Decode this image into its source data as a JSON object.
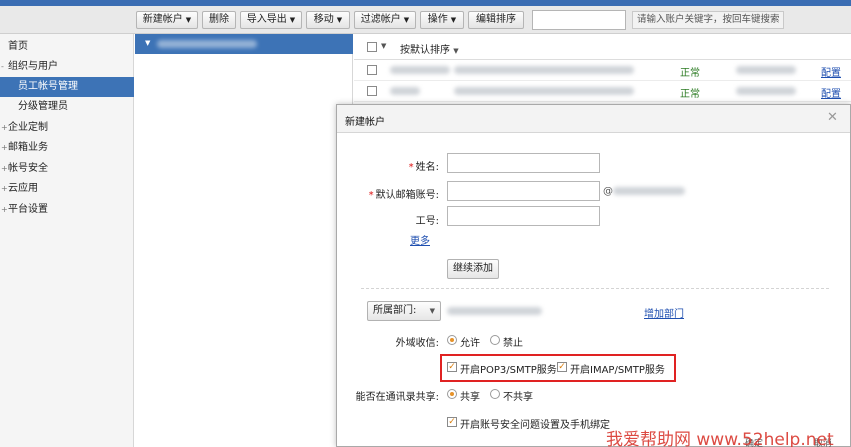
{
  "toolbar": {
    "new_account": "新建帐户",
    "delete": "删除",
    "import_export": "导入导出",
    "move": "移动",
    "filter_account": "过滤帐户",
    "operation": "操作",
    "edit_sort": "编辑排序",
    "search_value": "",
    "search_hint": "请输入账户关键字，按回车键搜索"
  },
  "sidebar": {
    "items": [
      {
        "label": "首页"
      },
      {
        "label": "组织与用户"
      },
      {
        "label": "员工帐号管理"
      },
      {
        "label": "分级管理员"
      },
      {
        "label": "企业定制"
      },
      {
        "label": "邮箱业务"
      },
      {
        "label": "帐号安全"
      },
      {
        "label": "云应用"
      },
      {
        "label": "平台设置"
      }
    ]
  },
  "list": {
    "sort_label": "按默认排序",
    "rows": [
      {
        "status": "正常",
        "action": "配置"
      },
      {
        "status": "正常",
        "action": "配置"
      }
    ]
  },
  "dialog": {
    "title": "新建帐户",
    "name_label": "姓名:",
    "email_label": "默认邮箱账号:",
    "email_at": "@",
    "employee_id_label": "工号:",
    "more_link": "更多",
    "continue_add": "继续添加",
    "department_select": "所属部门:",
    "add_department_link": "增加部门",
    "external_mail_label": "外域收信:",
    "allow": "允许",
    "forbid": "禁止",
    "pop3_smtp": "开启POP3/SMTP服务",
    "imap_smtp": "开启IMAP/SMTP服务",
    "share_contacts_label": "能否在通讯录共享:",
    "share": "共享",
    "no_share": "不共享",
    "security_binding": "开启账号安全问题设置及手机绑定",
    "confirm": "确定",
    "cancel": "取消"
  },
  "watermark": "我爱帮助网 www.52help.net",
  "colors": {
    "accent_blue": "#3d73b6",
    "status_green": "#2a7a21",
    "highlight_red": "#e02222",
    "radio_orange": "#e6922a"
  }
}
